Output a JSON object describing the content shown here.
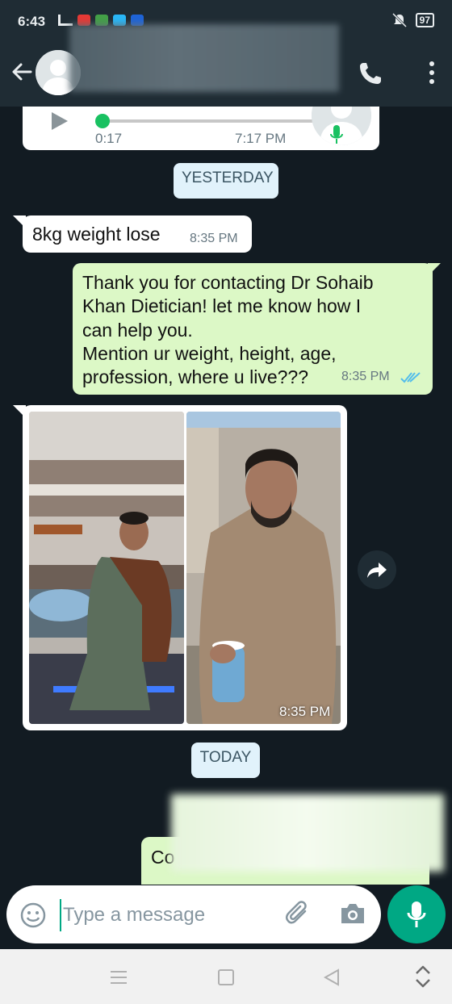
{
  "status_bar": {
    "time": "6:43",
    "battery": "97"
  },
  "header": {
    "back_icon": "arrow-left-icon",
    "call_icon": "phone-icon",
    "menu_icon": "more-vertical-icon"
  },
  "messages": {
    "voice": {
      "duration": "0:17",
      "time": "7:17 PM"
    },
    "date_yesterday": "YESTERDAY",
    "incoming_text": {
      "text": "8kg weight lose",
      "time": "8:35 PM"
    },
    "outgoing_text": {
      "text": "Thank you for contacting Dr Sohaib\nKhan Dietician! let me know how I\ncan help you.\nMention ur weight, height, age,\nprofession, where u live???",
      "time": "8:35 PM"
    },
    "photo": {
      "time": "8:35 PM"
    },
    "date_today": "TODAY",
    "outgoing_partial": {
      "text": "Co"
    }
  },
  "composer": {
    "placeholder": "Type a message"
  },
  "colors": {
    "header_bg": "#1f2c34",
    "chat_bg": "#121b22",
    "outgoing_bubble": "#dcf8c6",
    "incoming_bubble": "#ffffff",
    "accent": "#00a884",
    "read_ticks": "#53bdeb"
  }
}
